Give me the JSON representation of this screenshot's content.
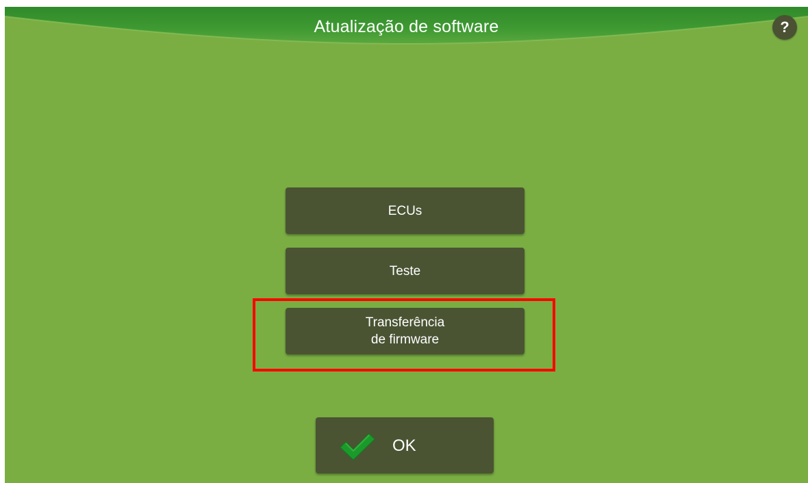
{
  "header": {
    "title": "Atualização de software",
    "help_label": "?"
  },
  "menu": {
    "items": [
      {
        "label": "ECUs"
      },
      {
        "label": "Teste"
      },
      {
        "label": "Transferência\nde firmware"
      }
    ]
  },
  "footer": {
    "ok_label": "OK"
  },
  "icons": {
    "help": "question-mark-icon",
    "ok": "checkmark-icon"
  },
  "colors": {
    "background": "#7aae43",
    "button": "#4a5433",
    "highlight": "#ff0000",
    "checkmark": "#1a9a2a"
  }
}
